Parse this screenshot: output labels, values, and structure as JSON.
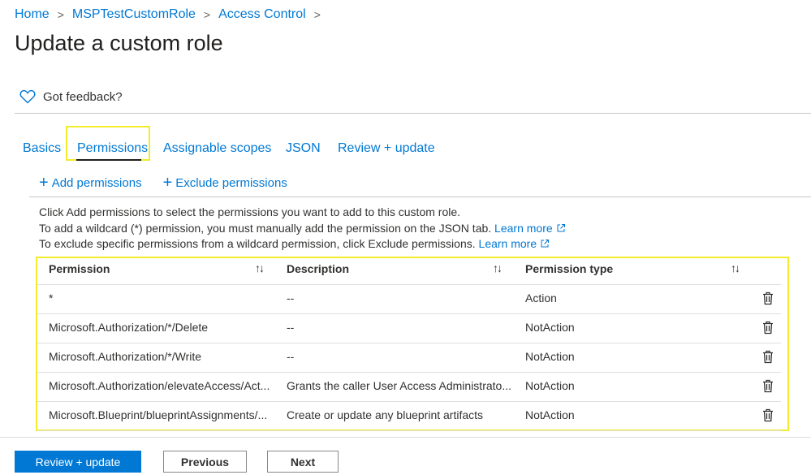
{
  "breadcrumb": {
    "items": [
      "Home",
      "MSPTestCustomRole",
      "Access Control"
    ],
    "separator": ">"
  },
  "page_title": "Update a custom role",
  "feedback": {
    "label": "Got feedback?",
    "icon": "heart-icon"
  },
  "tabs": [
    {
      "label": "Basics",
      "active": false
    },
    {
      "label": "Permissions",
      "active": true
    },
    {
      "label": "Assignable scopes",
      "active": false
    },
    {
      "label": "JSON",
      "active": false
    },
    {
      "label": "Review + update",
      "active": false
    }
  ],
  "toolbar": {
    "add_permissions": "Add permissions",
    "exclude_permissions": "Exclude permissions"
  },
  "info": {
    "line1": "Click Add permissions to select the permissions you want to add to this custom role.",
    "line2": "To add a wildcard (*) permission, you must manually add the permission on the JSON tab.",
    "line3": "To exclude specific permissions from a wildcard permission, click Exclude permissions.",
    "learn_more": "Learn more"
  },
  "table": {
    "columns": [
      "Permission",
      "Description",
      "Permission type"
    ],
    "sort_glyph": "↑↓",
    "rows": [
      {
        "permission": "*",
        "description": "--",
        "type": "Action"
      },
      {
        "permission": "Microsoft.Authorization/*/Delete",
        "description": "--",
        "type": "NotAction"
      },
      {
        "permission": "Microsoft.Authorization/*/Write",
        "description": "--",
        "type": "NotAction"
      },
      {
        "permission": "Microsoft.Authorization/elevateAccess/Act...",
        "description": "Grants the caller User Access Administrato...",
        "type": "NotAction"
      },
      {
        "permission": "Microsoft.Blueprint/blueprintAssignments/...",
        "description": "Create or update any blueprint artifacts",
        "type": "NotAction"
      }
    ]
  },
  "footer": {
    "primary": "Review + update",
    "previous": "Previous",
    "next": "Next"
  },
  "colors": {
    "accent": "#0078d4",
    "highlight": "#f3eb2d",
    "text": "#323130"
  }
}
